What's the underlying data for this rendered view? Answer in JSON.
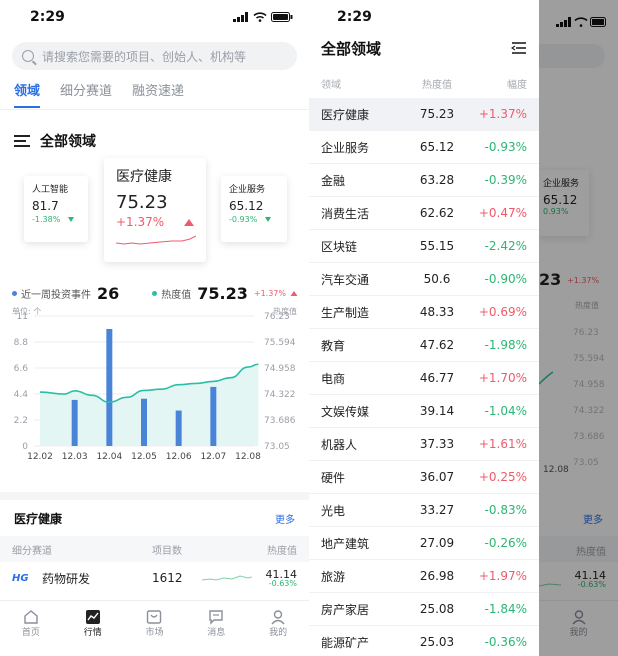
{
  "status": {
    "time": "2:29"
  },
  "search": {
    "placeholder": "请搜索您需要的项目、创始人、机构等"
  },
  "tabs": [
    {
      "label": "领域",
      "active": true
    },
    {
      "label": "细分赛道",
      "active": false
    },
    {
      "label": "融资速递",
      "active": false
    }
  ],
  "section": {
    "title": "全部领域"
  },
  "cards": {
    "left": {
      "name": "人工智能",
      "value": "81.7",
      "change": "-1.38%"
    },
    "center": {
      "name": "医疗健康",
      "value": "75.23",
      "change": "+1.37%"
    },
    "right": {
      "name": "企业服务",
      "value": "65.12",
      "change": "-0.93%"
    }
  },
  "stats": {
    "events_label": "近一周投资事件",
    "events_value": "26",
    "heat_label": "热度值",
    "heat_value": "75.23",
    "heat_change": "+1.37%"
  },
  "chart_data": {
    "type": "bar",
    "unit_label": "单位: 个",
    "right_axis_label": "热度值",
    "categories": [
      "12.02",
      "12.03",
      "12.04",
      "12.05",
      "12.06",
      "12.07",
      "12.08"
    ],
    "left_ticks": [
      "0",
      "2.2",
      "4.4",
      "6.6",
      "8.8",
      "11"
    ],
    "right_ticks": [
      "73.05",
      "73.686",
      "74.322",
      "74.958",
      "75.594",
      "76.23"
    ],
    "ylim": [
      0,
      11
    ],
    "y2lim": [
      73.05,
      76.23
    ],
    "series": [
      {
        "kind": "bar",
        "values": [
          null,
          3.9,
          9.9,
          4.0,
          3.0,
          5.0,
          null
        ]
      },
      {
        "kind": "line",
        "x": [
          0,
          0.7,
          1,
          1.5,
          2,
          2.5,
          3,
          3.5,
          4,
          4.5,
          5,
          5.5,
          6,
          6.3
        ],
        "values": [
          74.37,
          74.32,
          74.4,
          74.29,
          74.12,
          74.24,
          74.41,
          74.44,
          74.55,
          74.58,
          74.63,
          74.72,
          74.98,
          75.05
        ]
      }
    ],
    "colors": {
      "bar": "#4a84d8",
      "line": "#2bbfa5",
      "fill": "#e3f6f4"
    }
  },
  "list": {
    "title": "医疗健康",
    "more": "更多",
    "columns": [
      "细分赛道",
      "项目数",
      "热度值"
    ],
    "rows": [
      {
        "logo": "HG",
        "name": "药物研发",
        "count": "1612",
        "value": "41.14",
        "change": "-0.63%"
      }
    ]
  },
  "tabbar": [
    {
      "label": "首页",
      "icon": "home-icon",
      "active": false
    },
    {
      "label": "行情",
      "icon": "trend-icon",
      "active": true
    },
    {
      "label": "市场",
      "icon": "market-icon",
      "active": false
    },
    {
      "label": "消息",
      "icon": "message-icon",
      "active": false
    },
    {
      "label": "我的",
      "icon": "profile-icon",
      "active": false
    }
  ],
  "drawer": {
    "title": "全部领域",
    "columns": [
      "领域",
      "热度值",
      "幅度"
    ],
    "rows": [
      {
        "name": "医疗健康",
        "value": "75.23",
        "change": "+1.37%"
      },
      {
        "name": "企业服务",
        "value": "65.12",
        "change": "-0.93%"
      },
      {
        "name": "金融",
        "value": "63.28",
        "change": "-0.39%"
      },
      {
        "name": "消费生活",
        "value": "62.62",
        "change": "+0.47%"
      },
      {
        "name": "区块链",
        "value": "55.15",
        "change": "-2.42%"
      },
      {
        "name": "汽车交通",
        "value": "50.6",
        "change": "-0.90%"
      },
      {
        "name": "生产制造",
        "value": "48.33",
        "change": "+0.69%"
      },
      {
        "name": "教育",
        "value": "47.62",
        "change": "-1.98%"
      },
      {
        "name": "电商",
        "value": "46.77",
        "change": "+1.70%"
      },
      {
        "name": "文娱传媒",
        "value": "39.14",
        "change": "-1.04%"
      },
      {
        "name": "机器人",
        "value": "37.33",
        "change": "+1.61%"
      },
      {
        "name": "硬件",
        "value": "36.07",
        "change": "+0.25%"
      },
      {
        "name": "光电",
        "value": "33.27",
        "change": "-0.83%"
      },
      {
        "name": "地产建筑",
        "value": "27.09",
        "change": "-0.26%"
      },
      {
        "name": "旅游",
        "value": "26.98",
        "change": "+1.97%"
      },
      {
        "name": "房产家居",
        "value": "25.08",
        "change": "-1.84%"
      },
      {
        "name": "能源矿产",
        "value": "25.03",
        "change": "-0.36%"
      }
    ]
  },
  "behind": {
    "value_partial": "23",
    "change": "+1.37%",
    "right_label": "热度值",
    "ticks": [
      "76.23",
      "75.594",
      "74.958",
      "74.322",
      "73.686",
      "73.05"
    ],
    "last_date": "12.08",
    "more": "更多",
    "col": "热度值",
    "val": "41.14",
    "chg": "-0.63%",
    "card_name": "企业服务",
    "card_value": "65.12",
    "card_change": "0.93%",
    "tab_label": "我的"
  }
}
